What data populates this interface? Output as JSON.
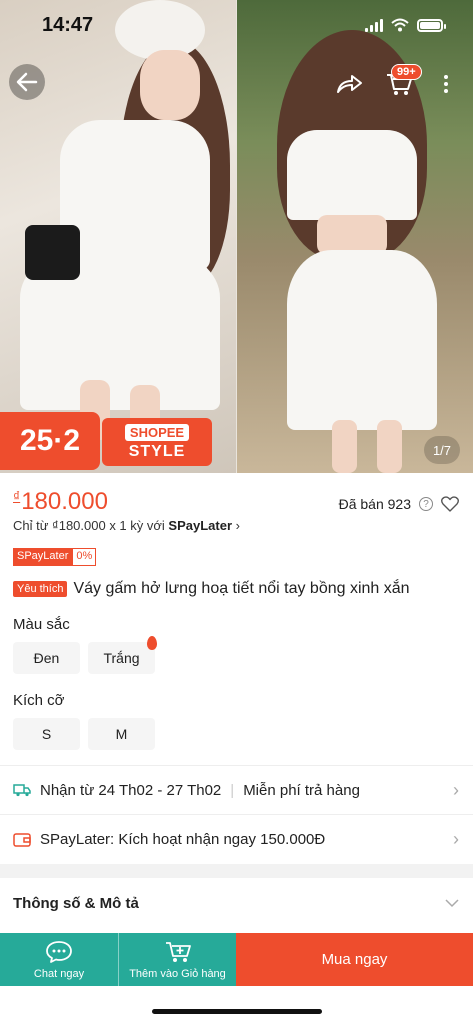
{
  "status_bar": {
    "time": "14:47"
  },
  "header": {
    "cart_badge": "99+",
    "image_counter": "1/7"
  },
  "promo": {
    "date": "25·2",
    "brand_top": "SHOPEE",
    "brand_bottom": "STYLE"
  },
  "product": {
    "currency": "₫",
    "price": "180.000",
    "sold_text": "Đã bán 923",
    "installment_prefix": "Chỉ từ ₫180.000 x 1 kỳ với ",
    "installment_brand": "SPayLater",
    "installment_chevron": "›",
    "spaylater_tag": "SPayLater",
    "spaylater_rate": "0%",
    "favorite_tag": "Yêu thích",
    "title": "Váy gấm hở lưng hoạ tiết nổi tay bồng xinh xắn"
  },
  "variations": {
    "color_label": "Màu sắc",
    "colors": [
      "Đen",
      "Trắng"
    ],
    "size_label": "Kích cỡ",
    "sizes": [
      "S",
      "M"
    ]
  },
  "shipping": {
    "delivery": "Nhận từ 24 Th02 - 27 Th02",
    "returns": "Miễn phí trả hàng"
  },
  "spaylater_row": {
    "text": "SPayLater: Kích hoạt nhận ngay 150.000Đ"
  },
  "specs": {
    "label": "Thông số & Mô tả"
  },
  "bottom_bar": {
    "chat": "Chat ngay",
    "add_to_cart": "Thêm vào Giỏ hàng",
    "buy_now": "Mua ngay"
  },
  "colors": {
    "accent": "#ee4d2d",
    "teal": "#26aa99"
  },
  "icons": [
    "back-icon",
    "share-icon",
    "cart-icon",
    "more-icon",
    "question-icon",
    "heart-icon",
    "truck-icon",
    "wallet-icon",
    "chevron-right-icon",
    "chevron-down-icon",
    "chat-icon",
    "add-cart-icon"
  ]
}
